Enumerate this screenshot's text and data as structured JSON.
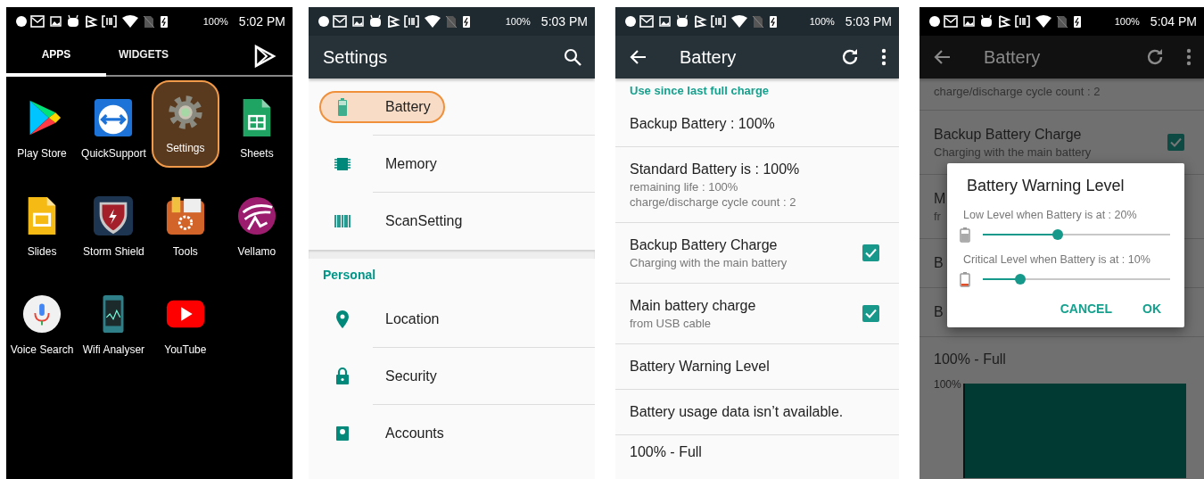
{
  "screens": [
    {
      "kind": "launcher",
      "status_bar": {
        "battery": "100%",
        "time": "5:02 PM"
      },
      "tabs": [
        {
          "label": "APPS",
          "selected": true
        },
        {
          "label": "WIDGETS",
          "selected": false
        }
      ],
      "apps": [
        {
          "label": "Play Store",
          "highlighted": false
        },
        {
          "label": "QuickSupport",
          "highlighted": false
        },
        {
          "label": "Settings",
          "highlighted": true
        },
        {
          "label": "Sheets",
          "highlighted": false
        },
        {
          "label": "Slides",
          "highlighted": false
        },
        {
          "label": "Storm Shield",
          "highlighted": false
        },
        {
          "label": "Tools",
          "highlighted": false
        },
        {
          "label": "Vellamo",
          "highlighted": false
        },
        {
          "label": "Voice Search",
          "highlighted": false
        },
        {
          "label": "Wifi Analyser",
          "highlighted": false
        },
        {
          "label": "YouTube",
          "highlighted": false
        }
      ]
    },
    {
      "kind": "settings",
      "status_bar": {
        "battery": "100%",
        "time": "5:03 PM"
      },
      "title": "Settings",
      "groups": [
        {
          "items": [
            {
              "label": "Battery",
              "highlighted": true
            },
            {
              "label": "Memory",
              "highlighted": false
            },
            {
              "label": "ScanSetting",
              "highlighted": false
            }
          ]
        },
        {
          "header": "Personal",
          "items": [
            {
              "label": "Location",
              "highlighted": false
            },
            {
              "label": "Security",
              "highlighted": false
            },
            {
              "label": "Accounts",
              "highlighted": false
            }
          ]
        }
      ]
    },
    {
      "kind": "battery",
      "status_bar": {
        "battery": "100%",
        "time": "5:03 PM"
      },
      "title": "Battery",
      "section_header": "Use since last full charge",
      "rows": [
        {
          "title": "Backup Battery : 100%"
        },
        {
          "title": "Standard Battery is : 100%",
          "summary_lines": [
            "remaining life : 100%",
            "charge/discharge cycle count : 2"
          ]
        },
        {
          "title": "Backup Battery Charge",
          "summary_lines": [
            "Charging with the main battery"
          ],
          "checked": true
        },
        {
          "title": "Main battery charge",
          "summary_lines": [
            "from USB cable"
          ],
          "checked": true
        },
        {
          "title": "Battery Warning Level"
        },
        {
          "title": "Battery usage data isn’t available."
        },
        {
          "title": "100% - Full"
        }
      ]
    },
    {
      "kind": "battery_dialog",
      "status_bar": {
        "battery": "100%",
        "time": "5:04 PM"
      },
      "title": "Battery",
      "rows": [
        {
          "summary_lines": [
            "charge/discharge cycle count : 2"
          ]
        },
        {
          "title": "Backup Battery Charge",
          "summary_lines": [
            "Charging with the main battery"
          ],
          "checked": true
        },
        {
          "title": "M",
          "summary_lines": [
            "fr"
          ]
        },
        {
          "title": "B"
        },
        {
          "title": "B"
        },
        {
          "title": "100% - Full"
        }
      ],
      "chart_label": "100%",
      "dialog": {
        "title": "Battery Warning Level",
        "sliders": [
          {
            "label": "Low Level when Battery is at : 20%",
            "level": 0.4
          },
          {
            "label": "Critical Level when Battery is at : 10%",
            "level": 0.2
          }
        ],
        "buttons": [
          "CANCEL",
          "OK"
        ]
      }
    }
  ]
}
